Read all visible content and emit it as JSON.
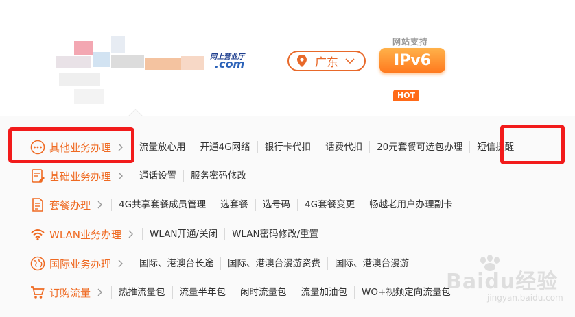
{
  "header": {
    "logo_text_top": "网上营业厅",
    "logo_text_domain": ".com",
    "region": {
      "label": "广东",
      "icon": "location-pin-icon",
      "dropdown_icon": "chevron-down-icon"
    },
    "ipv6": {
      "caption": "网站支持",
      "label": "IPv6"
    },
    "hot_badge": "HOT"
  },
  "menu": {
    "rows": [
      {
        "id": "other",
        "icon": "more-circle-icon",
        "label": "其他业务办理",
        "items": [
          "流量放心用",
          "开通4G网络",
          "银行卡代扣",
          "话费代扣",
          "20元套餐可选包办理",
          "短信提醒"
        ]
      },
      {
        "id": "basic",
        "icon": "document-edit-icon",
        "label": "基础业务办理",
        "items": [
          "通话设置",
          "服务密码修改"
        ]
      },
      {
        "id": "plan",
        "icon": "plan-document-icon",
        "label": "套餐办理",
        "items": [
          "4G共享套餐成员管理",
          "选套餐",
          "选号码",
          "4G套餐变更",
          "畅越老用户办理副卡"
        ]
      },
      {
        "id": "wlan",
        "icon": "wifi-icon",
        "label": "WLAN业务办理",
        "items": [
          "WLAN开通/关闭",
          "WLAN密码修改/重置"
        ]
      },
      {
        "id": "intl",
        "icon": "globe-icon",
        "label": "国际业务办理",
        "items": [
          "国际、港澳台长途",
          "国际、港澳台漫游资费",
          "国际、港澳台漫游"
        ]
      },
      {
        "id": "traffic",
        "icon": "shopping-cart-icon",
        "label": "订购流量",
        "items": [
          "热推流量包",
          "流量半年包",
          "闲时流量包",
          "流量加油包",
          "WO+视频定向流量包"
        ]
      }
    ]
  },
  "watermark": {
    "main": "Baidu经验",
    "sub": "jingyan.baidu.com"
  },
  "colors": {
    "accent": "#ef6a22",
    "highlight_box": "#f21b1b",
    "text": "#333333"
  }
}
